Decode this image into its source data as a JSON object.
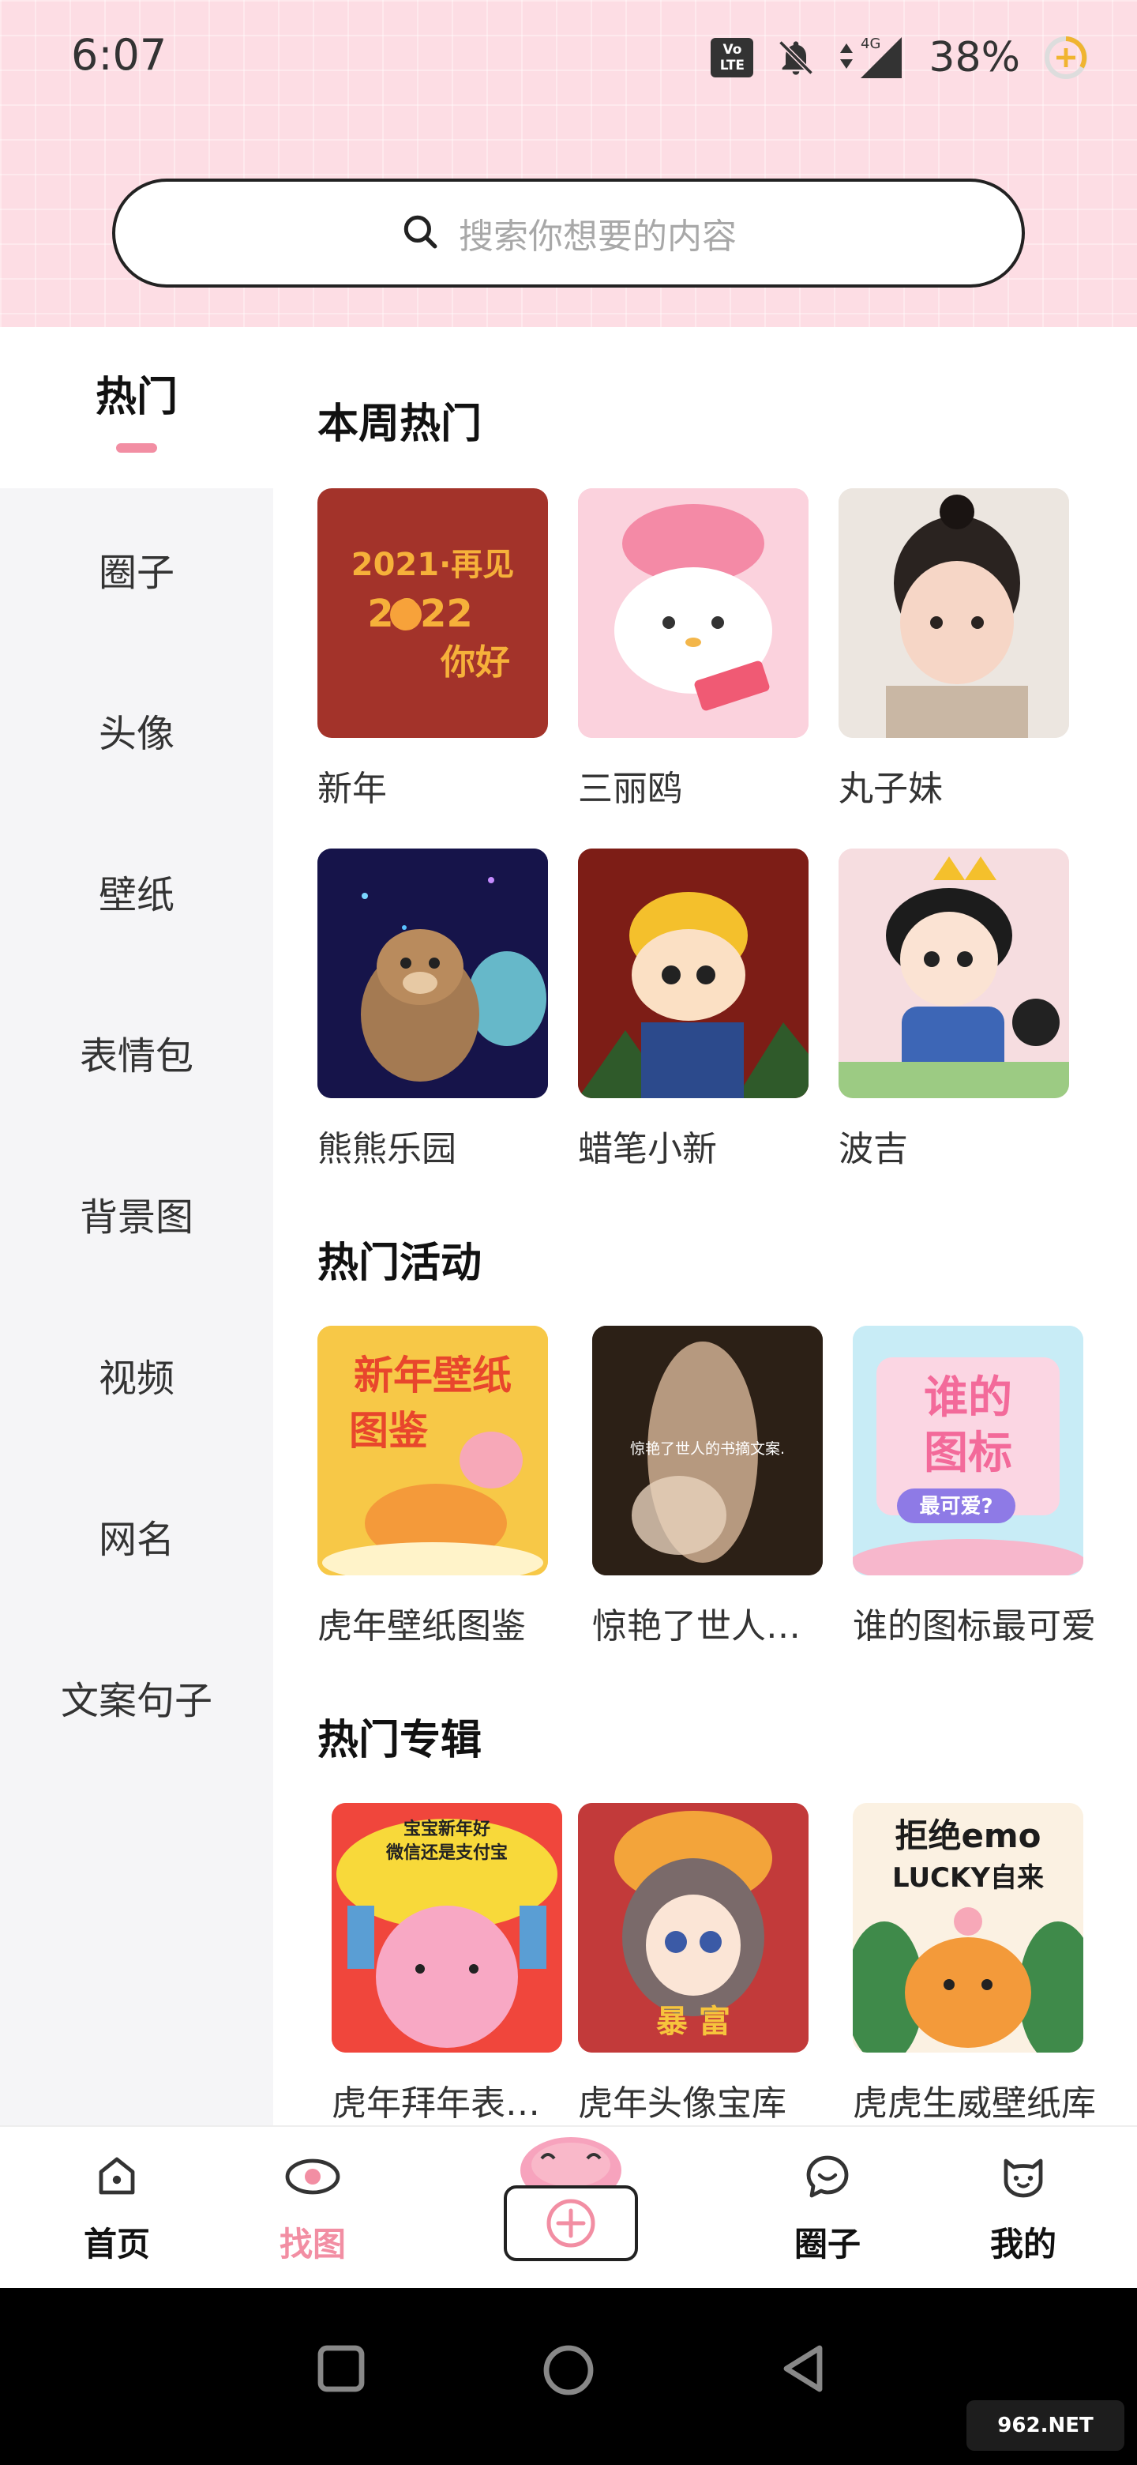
{
  "status": {
    "time": "6:07",
    "battery": "38%",
    "volte_line1": "Vo",
    "volte_line2": "LTE",
    "network": "4G"
  },
  "search": {
    "placeholder": "搜索你想要的内容"
  },
  "sidebar": {
    "active": "热门",
    "items": [
      "圈子",
      "头像",
      "壁纸",
      "表情包",
      "背景图",
      "视频",
      "网名",
      "文案句子"
    ]
  },
  "sections": {
    "weekly_title": "本周热门",
    "weekly": [
      "新年",
      "三丽鸥",
      "丸子妹",
      "熊熊乐园",
      "蜡笔小新",
      "波吉"
    ],
    "events_title": "热门活动",
    "events": [
      "虎年壁纸图鉴",
      "惊艳了世人的...",
      "谁的图标最可爱"
    ],
    "albums_title": "热门专辑",
    "albums": [
      "虎年拜年表情库",
      "虎年头像宝库",
      "虎虎生威壁纸库"
    ]
  },
  "thumb_text": {
    "newyear_1": "2021·再见",
    "newyear_2": "2022",
    "newyear_3": "你好",
    "event1_1": "新年壁纸",
    "event1_2": "图鉴",
    "event2": "惊艳了世人的书摘文案.",
    "event3_1": "谁的",
    "event3_2": "图标",
    "event3_3": "最可爱?",
    "album1_top": "宝宝新年好\n微信还是支付宝",
    "album2_text": "暴 富",
    "album3_1": "拒绝emo",
    "album3_2": "LUCKY自来"
  },
  "bottom_nav": {
    "home": "首页",
    "find": "找图",
    "circle": "圈子",
    "mine": "我的"
  },
  "watermark": "962.NET",
  "colors": {
    "accent": "#f28ea3",
    "header_bg": "#fddde4",
    "sidebar_bg": "#f5f5f7"
  }
}
